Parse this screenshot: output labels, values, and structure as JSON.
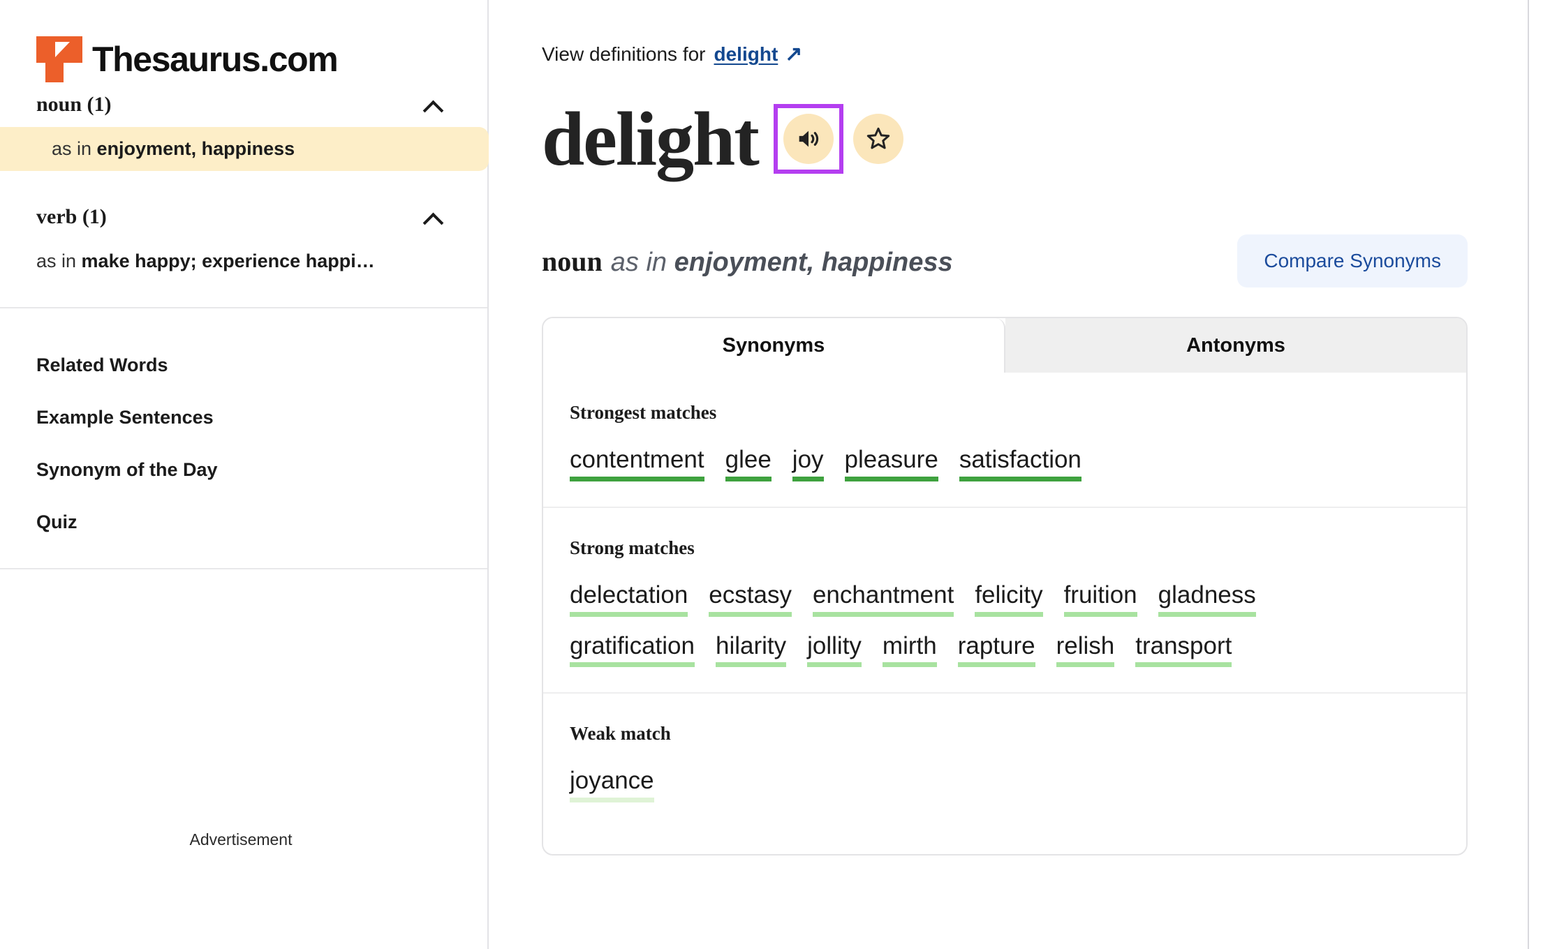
{
  "brand": {
    "name": "Thesaurus.com",
    "logo_icon": "thesaurus-t-logo",
    "accent_color": "#ec5f2a"
  },
  "sidebar": {
    "pos_groups": [
      {
        "title": "noun (1)",
        "chevron_icon": "chevron-up-icon",
        "senses": [
          {
            "prefix": "as in ",
            "label": "enjoyment, happiness",
            "active": true
          }
        ]
      },
      {
        "title": "verb (1)",
        "chevron_icon": "chevron-up-icon",
        "senses": [
          {
            "prefix": "as in ",
            "label": "make happy; experience happi…",
            "active": false
          }
        ]
      }
    ],
    "nav_links": [
      "Related Words",
      "Example Sentences",
      "Synonym of the Day",
      "Quiz"
    ],
    "advertisement_label": "Advertisement"
  },
  "main": {
    "definitions_prefix": "View definitions for",
    "definitions_link": "delight",
    "external_link_icon": "external-link-arrow-icon",
    "headword": "delight",
    "audio_icon": "speaker-audio-icon",
    "favorite_icon": "star-outline-icon",
    "highlight_color": "#b43ef0",
    "sense_pos": "noun",
    "sense_prefix": "as in ",
    "sense_label": "enjoyment, happiness",
    "compare_button": "Compare Synonyms",
    "tabs": [
      {
        "label": "Synonyms",
        "active": true
      },
      {
        "label": "Antonyms",
        "active": false
      }
    ],
    "match_groups": [
      {
        "title": "Strongest matches",
        "strength": "strongest",
        "underline_color": "#3fa23f",
        "rows": [
          [
            "contentment",
            "glee",
            "joy",
            "pleasure",
            "satisfaction"
          ]
        ]
      },
      {
        "title": "Strong matches",
        "strength": "strong",
        "underline_color": "#a8e2a0",
        "rows": [
          [
            "delectation",
            "ecstasy",
            "enchantment",
            "felicity",
            "fruition",
            "gladness"
          ],
          [
            "gratification",
            "hilarity",
            "jollity",
            "mirth",
            "rapture",
            "relish",
            "transport"
          ]
        ]
      },
      {
        "title": "Weak match",
        "strength": "weak",
        "underline_color": "#dff3d6",
        "rows": [
          [
            "joyance"
          ]
        ]
      }
    ]
  }
}
